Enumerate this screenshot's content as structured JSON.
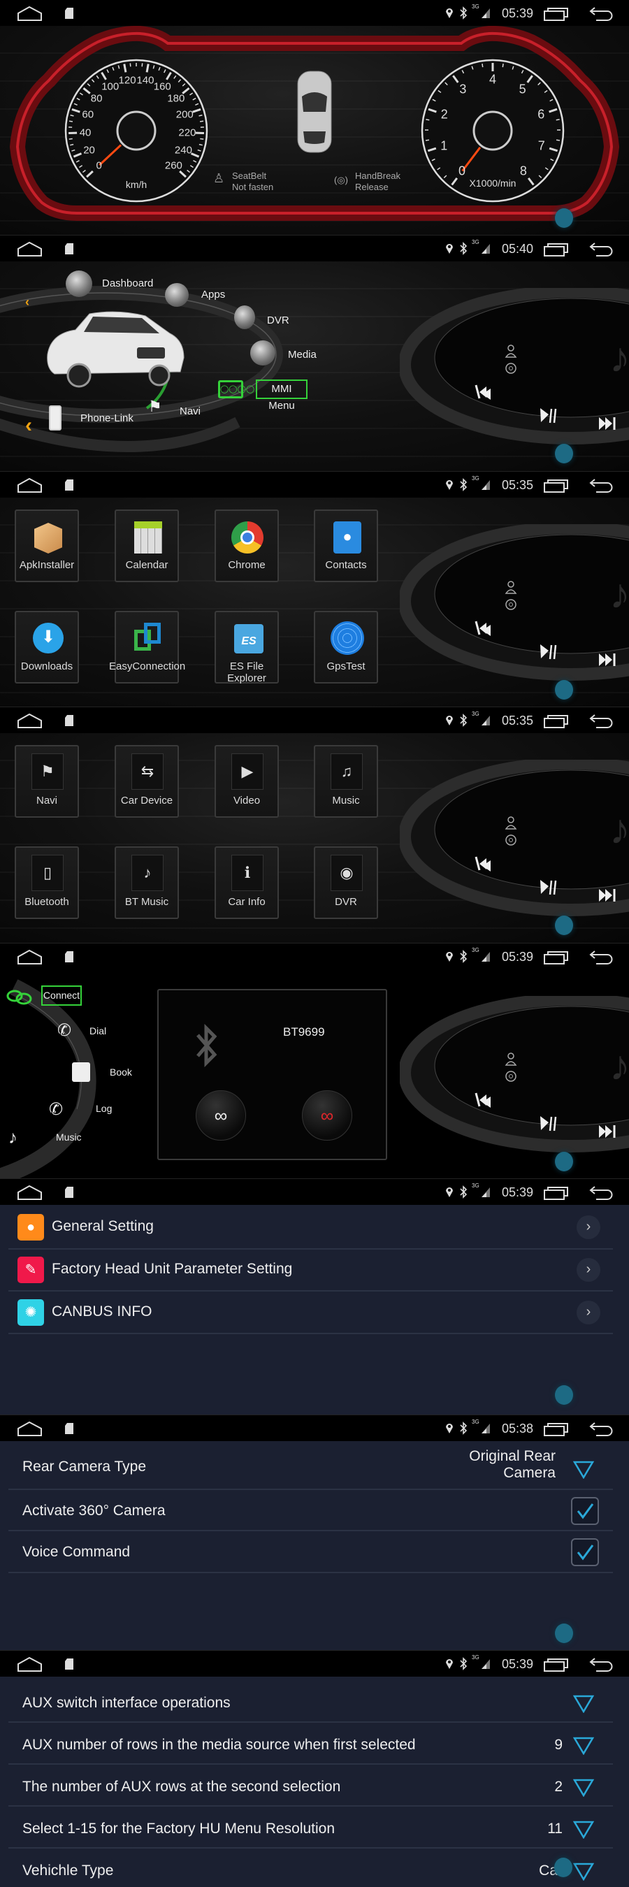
{
  "status_bar": {
    "icons": [
      "home-icon",
      "sd-card-icon",
      "location-icon",
      "bluetooth-icon",
      "3g-signal-icon",
      "recent-apps-icon",
      "back-icon"
    ],
    "network_label": "3G",
    "times": [
      "05:39",
      "05:40",
      "05:35",
      "05:35",
      "05:39",
      "05:39",
      "05:38",
      "05:39"
    ]
  },
  "dashboard": {
    "speed_labels": [
      "0",
      "20",
      "40",
      "60",
      "80",
      "100",
      "120",
      "140",
      "160",
      "180",
      "200",
      "220",
      "240",
      "260"
    ],
    "speed_unit": "km/h",
    "speed_value": 0,
    "rpm_labels": [
      "0",
      "1",
      "2",
      "3",
      "4",
      "5",
      "6",
      "7",
      "8"
    ],
    "rpm_unit": "X1000/min",
    "rpm_value": 0,
    "seatbelt": {
      "line1": "SeatBelt",
      "line2": "Not fasten"
    },
    "handbrake": {
      "line1": "HandBreak",
      "line2": "Release"
    },
    "frame_color": "#b3141c",
    "needle_color": "#ff4a12"
  },
  "mmi_menu": {
    "items": [
      {
        "label": "Dashboard",
        "icon": "gauge-icon"
      },
      {
        "label": "Apps",
        "icon": "apps-icon"
      },
      {
        "label": "DVR",
        "icon": "webcam-icon"
      },
      {
        "label": "Media",
        "icon": "disc-icon"
      },
      {
        "label": "MMI Menu",
        "icon": "audi-grille-icon",
        "selected": true
      },
      {
        "label": "Navi",
        "icon": "checkered-flag-icon"
      },
      {
        "label": "Phone-Link",
        "icon": "phone-link-icon"
      }
    ],
    "accent": "#35d23a"
  },
  "media_widget": {
    "controls": [
      "previous-icon",
      "play-pause-icon",
      "next-icon"
    ]
  },
  "apps_page1": {
    "apps": [
      {
        "label": "ApkInstaller",
        "icon": "package-icon"
      },
      {
        "label": "Calendar",
        "icon": "calendar-icon"
      },
      {
        "label": "Chrome",
        "icon": "chrome-icon"
      },
      {
        "label": "Contacts",
        "icon": "contacts-icon"
      },
      {
        "label": "Downloads",
        "icon": "download-icon"
      },
      {
        "label": "EasyConnection",
        "icon": "easyconnection-icon"
      },
      {
        "label": "ES File Explorer",
        "icon": "es-folder-icon"
      },
      {
        "label": "GpsTest",
        "icon": "gps-globe-icon"
      }
    ]
  },
  "apps_page2": {
    "apps": [
      {
        "label": "Navi",
        "icon": "checkered-flag-icon",
        "glyph": "⚑"
      },
      {
        "label": "Car Device",
        "icon": "usb-icon",
        "glyph": "⇆"
      },
      {
        "label": "Video",
        "icon": "play-icon",
        "glyph": "▶"
      },
      {
        "label": "Music",
        "icon": "music-note-icon",
        "glyph": "♫"
      },
      {
        "label": "Bluetooth",
        "icon": "phone-icon",
        "glyph": "▯"
      },
      {
        "label": "BT Music",
        "icon": "bt-music-icon",
        "glyph": "♪"
      },
      {
        "label": "Car Info",
        "icon": "car-info-icon",
        "glyph": "ℹ"
      },
      {
        "label": "DVR",
        "icon": "webcam-icon",
        "glyph": "◉"
      }
    ]
  },
  "bluetooth": {
    "menu": [
      {
        "label": "Connect",
        "icon": "link-rings-icon",
        "selected": true
      },
      {
        "label": "Dial",
        "icon": "dialpad-icon"
      },
      {
        "label": "Book",
        "icon": "phonebook-icon"
      },
      {
        "label": "Log",
        "icon": "call-log-icon"
      },
      {
        "label": "Music",
        "icon": "bt-music-icon"
      }
    ],
    "device_name": "BT9699",
    "connect_button": "link-icon",
    "disconnect_button": "unlink-icon"
  },
  "settings_main": {
    "items": [
      {
        "label": "General Setting",
        "icon": "bulb-icon",
        "color": "#ff8a1a"
      },
      {
        "label": "Factory Head Unit Parameter Setting",
        "icon": "wrench-icon",
        "color": "#f0194a"
      },
      {
        "label": "CANBUS INFO",
        "icon": "wheel-icon",
        "color": "#2fd2e6"
      }
    ]
  },
  "camera_settings": {
    "rows": [
      {
        "label": "Rear Camera Type",
        "value_line1": "Original Rear",
        "value_line2": "Camera",
        "control": "dropdown"
      },
      {
        "label": "Activate 360° Camera",
        "control": "checkbox",
        "checked": true
      },
      {
        "label": "Voice Command",
        "control": "checkbox",
        "checked": true
      }
    ]
  },
  "aux_settings": {
    "rows": [
      {
        "label": "AUX switch interface operations",
        "value": ""
      },
      {
        "label": "AUX number of rows in the media source when first selected",
        "value": "9"
      },
      {
        "label": "The number of AUX rows at the second selection",
        "value": "2"
      },
      {
        "label": "Select 1-15 for the Factory HU Menu Resolution",
        "value": "11"
      },
      {
        "label": "Vehichle Type",
        "value": "Car"
      }
    ],
    "accent": "#2aa8d8"
  }
}
